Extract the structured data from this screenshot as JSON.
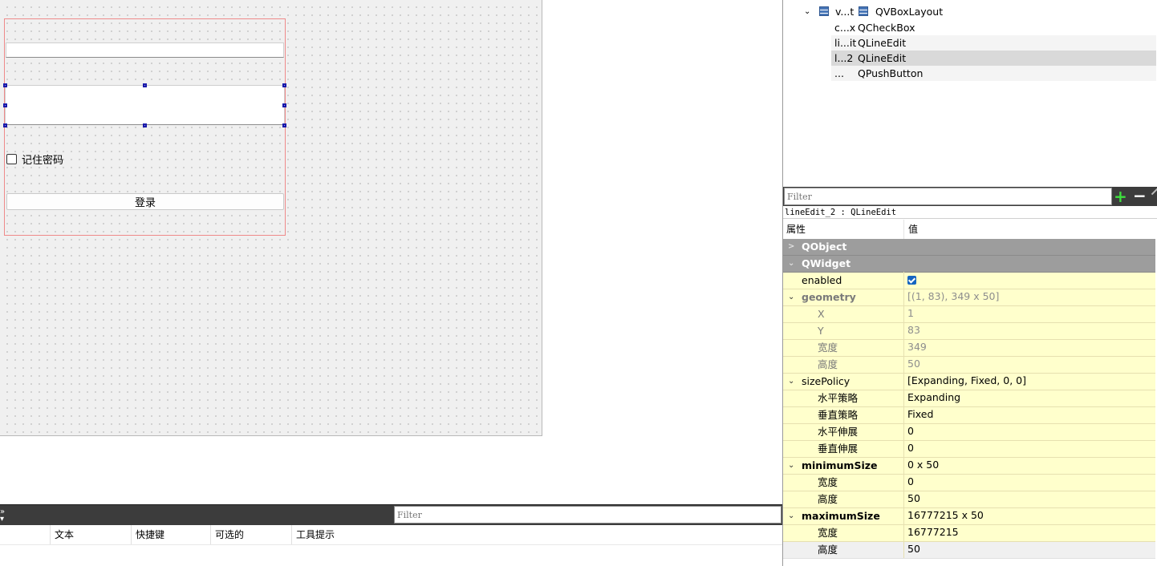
{
  "form": {
    "remember_label": "记住密码",
    "login_label": "登录"
  },
  "object_inspector": {
    "rows": [
      {
        "name": "v...t",
        "class": "QVBoxLayout"
      },
      {
        "name": "c...x",
        "class": "QCheckBox"
      },
      {
        "name": "li...it",
        "class": "QLineEdit"
      },
      {
        "name": "l...2",
        "class": "QLineEdit"
      },
      {
        "name": "...",
        "class": "QPushButton"
      }
    ]
  },
  "property_editor": {
    "filter_placeholder": "Filter",
    "object_label": "lineEdit_2 : QLineEdit",
    "header_property": "属性",
    "header_value": "值",
    "sections": {
      "qobject": "QObject",
      "qwidget": "QWidget"
    },
    "props": {
      "enabled": {
        "name": "enabled",
        "checked": true
      },
      "geometry": {
        "name": "geometry",
        "value": "[(1, 83), 349 x 50]"
      },
      "geo_x": {
        "name": "X",
        "value": "1"
      },
      "geo_y": {
        "name": "Y",
        "value": "83"
      },
      "geo_w": {
        "name": "宽度",
        "value": "349"
      },
      "geo_h": {
        "name": "高度",
        "value": "50"
      },
      "sizepolicy": {
        "name": "sizePolicy",
        "value": "[Expanding, Fixed, 0, 0]"
      },
      "sp_h": {
        "name": "水平策略",
        "value": "Expanding"
      },
      "sp_v": {
        "name": "垂直策略",
        "value": "Fixed"
      },
      "sp_hs": {
        "name": "水平伸展",
        "value": "0"
      },
      "sp_vs": {
        "name": "垂直伸展",
        "value": "0"
      },
      "minsize": {
        "name": "minimumSize",
        "value": "0 x 50"
      },
      "min_w": {
        "name": "宽度",
        "value": "0"
      },
      "min_h": {
        "name": "高度",
        "value": "50"
      },
      "maxsize": {
        "name": "maximumSize",
        "value": "16777215 x 50"
      },
      "max_w": {
        "name": "宽度",
        "value": "16777215"
      },
      "max_h": {
        "name": "高度",
        "value": "50"
      }
    }
  },
  "action_editor": {
    "filter_placeholder": "Filter",
    "columns": [
      "文本",
      "快捷键",
      "可选的",
      "工具提示"
    ]
  },
  "colors": {
    "checkbox_accent": "#1565c0",
    "property_row_bg": "#ffffcc",
    "section_bg": "#9d9d9d",
    "add_icon": "#3ee03e",
    "form_border": "#ef8a8a"
  }
}
